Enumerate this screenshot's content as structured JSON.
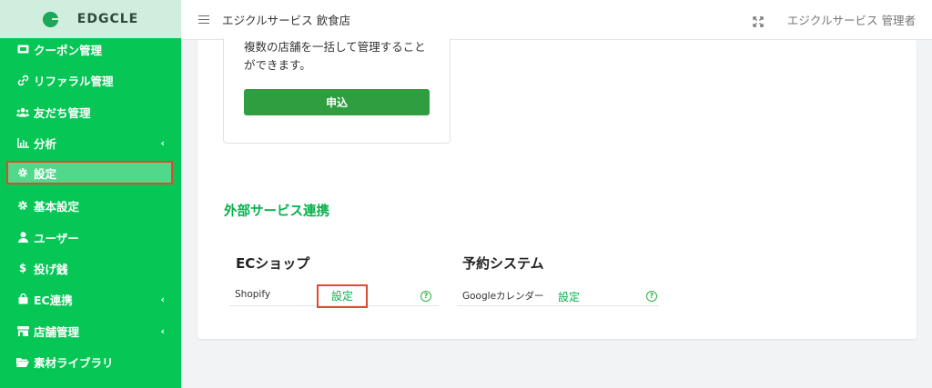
{
  "brand": {
    "name": "EDGCLE"
  },
  "sidebar": {
    "items": [
      {
        "label": "クーポン管理",
        "icon": "ticket-icon",
        "has_chevron": false
      },
      {
        "label": "リファラル管理",
        "icon": "link-icon",
        "has_chevron": false
      },
      {
        "label": "友だち管理",
        "icon": "users-icon",
        "has_chevron": false
      },
      {
        "label": "分析",
        "icon": "chart-icon",
        "has_chevron": true
      },
      {
        "label": "設定",
        "icon": "gear-icon",
        "has_chevron": false,
        "active": true
      },
      {
        "label": "基本設定",
        "icon": "gear-icon",
        "has_chevron": false
      },
      {
        "label": "ユーザー",
        "icon": "user-icon",
        "has_chevron": false
      },
      {
        "label": "投げ銭",
        "icon": "dollar-icon",
        "has_chevron": false
      },
      {
        "label": "EC連携",
        "icon": "shopping-bag-icon",
        "has_chevron": true
      },
      {
        "label": "店舗管理",
        "icon": "store-icon",
        "has_chevron": true
      },
      {
        "label": "素材ライブラリ",
        "icon": "folder-icon",
        "has_chevron": false
      }
    ],
    "chevron": "‹"
  },
  "header": {
    "shop_title": "エジクルサービス 飲食店",
    "admin_name": "エジクルサービス 管理者"
  },
  "promo": {
    "text": "複数の店舗を一括して管理することができます。",
    "apply_label": "申込"
  },
  "integrations": {
    "section_title": "外部サービス連携",
    "groups": [
      {
        "heading": "ECショップ",
        "service": "Shopify",
        "link_label": "設定"
      },
      {
        "heading": "予約システム",
        "service": "Googleカレンダー",
        "link_label": "設定"
      }
    ],
    "help_glyph": "?"
  },
  "colors": {
    "sidebar": "#06c755",
    "accent": "#06b04c",
    "button": "#2e9e41",
    "highlight_border": "#e04a2f"
  }
}
